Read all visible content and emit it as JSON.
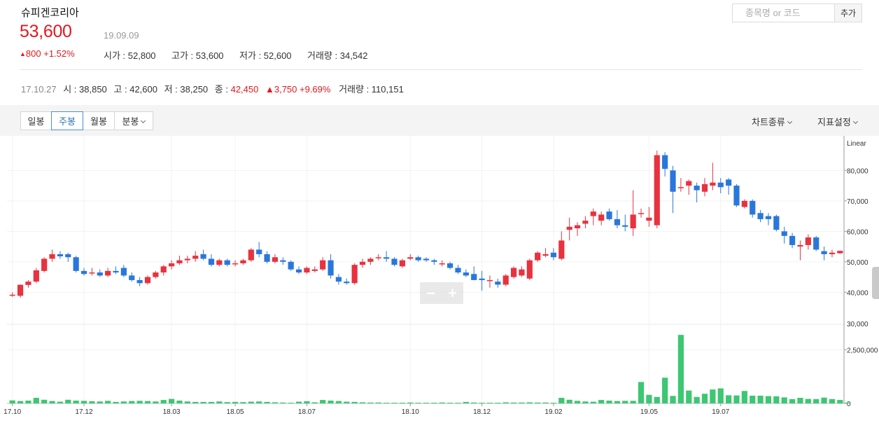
{
  "stock": {
    "name": "슈피겐코리아",
    "price": "53,600",
    "price_date": "19.09.09",
    "change_arrow": "▲",
    "change_text": "800 +1.52%",
    "quote": [
      {
        "label": "시가",
        "value": "52,800"
      },
      {
        "label": "고가",
        "value": "53,600"
      },
      {
        "label": "저가",
        "value": "52,600"
      },
      {
        "label": "거래량",
        "value": "34,542"
      }
    ]
  },
  "search": {
    "placeholder": "종목명 or 코드",
    "button": "추가"
  },
  "hover": {
    "date": "17.10.27",
    "open": "시 : 38,850",
    "high": "고 : 42,600",
    "low": "저 : 38,250",
    "close_label": "종 : ",
    "close_value": "42,450",
    "change": "▲3,750 +9.69%",
    "volume": "거래량 : 110,151"
  },
  "toolbar": {
    "tabs": [
      {
        "label": "일봉",
        "active": false
      },
      {
        "label": "주봉",
        "active": true
      },
      {
        "label": "월봉",
        "active": false
      },
      {
        "label": "분봉",
        "active": false
      }
    ],
    "chart_type": "차트종류",
    "indicator": "지표설정"
  },
  "zoom": {
    "minus": "−",
    "plus": "+"
  },
  "colors": {
    "up": "#e8323f",
    "down": "#2a77dc",
    "volume": "#3cc772",
    "accent": "#e5171d",
    "active_tab": "#2d72b8"
  },
  "chart_data": {
    "type": "candlestick",
    "scale_label": "Linear",
    "y_ticks": [
      40000,
      50000,
      60000,
      70000,
      80000
    ],
    "y_tick_labels": [
      "40,000",
      "50,000",
      "60,000",
      "70,000",
      "80,000"
    ],
    "volume_ticks": [
      0,
      2500000
    ],
    "volume_tick_labels": [
      "0",
      "2,500,000"
    ],
    "volume_top_label": "30,000",
    "x_labels": [
      "17.10",
      "17.12",
      "18.03",
      "18.05",
      "18.07",
      "18.10",
      "18.12",
      "19.02",
      "19.05",
      "19.07"
    ],
    "ohlc": [
      [
        39000,
        40000,
        38500,
        39200
      ],
      [
        38850,
        42600,
        38250,
        42450
      ],
      [
        42400,
        44000,
        41500,
        43500
      ],
      [
        43500,
        48000,
        43000,
        47200
      ],
      [
        47000,
        51500,
        46500,
        51000
      ],
      [
        51000,
        54000,
        50000,
        52500
      ],
      [
        52500,
        53500,
        51000,
        51800
      ],
      [
        52500,
        53000,
        50000,
        51500
      ],
      [
        51500,
        52000,
        46500,
        47000
      ],
      [
        47000,
        48000,
        45500,
        46000
      ],
      [
        46500,
        48000,
        45500,
        46500
      ],
      [
        46500,
        47500,
        45000,
        45500
      ],
      [
        45500,
        48000,
        45000,
        47000
      ],
      [
        47000,
        48500,
        46000,
        46500
      ],
      [
        48000,
        49000,
        45000,
        45500
      ],
      [
        45500,
        46500,
        43500,
        44000
      ],
      [
        44000,
        45000,
        42000,
        43000
      ],
      [
        43000,
        45500,
        42500,
        45000
      ],
      [
        45000,
        47000,
        44500,
        46500
      ],
      [
        46500,
        49000,
        45500,
        48500
      ],
      [
        48500,
        50500,
        47500,
        49500
      ],
      [
        49500,
        52000,
        49000,
        50500
      ],
      [
        50500,
        52000,
        49500,
        51000
      ],
      [
        51000,
        53500,
        50000,
        52000
      ],
      [
        52500,
        54000,
        50500,
        51000
      ],
      [
        51000,
        52500,
        48500,
        49000
      ],
      [
        49000,
        51000,
        48500,
        50500
      ],
      [
        50500,
        51000,
        48500,
        49000
      ],
      [
        49500,
        50500,
        48500,
        49500
      ],
      [
        49500,
        51000,
        49000,
        50500
      ],
      [
        50500,
        54500,
        50000,
        54000
      ],
      [
        54000,
        56500,
        51500,
        52500
      ],
      [
        52500,
        53500,
        49500,
        50000
      ],
      [
        50000,
        52500,
        49500,
        51500
      ],
      [
        50500,
        51500,
        49000,
        50000
      ],
      [
        50000,
        50500,
        47000,
        47500
      ],
      [
        47500,
        48500,
        46000,
        46500
      ],
      [
        46500,
        48500,
        46000,
        48000
      ],
      [
        47000,
        48500,
        46500,
        47500
      ],
      [
        47500,
        51500,
        47000,
        50500
      ],
      [
        50500,
        52500,
        44500,
        45500
      ],
      [
        45000,
        46000,
        42500,
        43500
      ],
      [
        43500,
        44500,
        42500,
        43000
      ],
      [
        43000,
        49500,
        42500,
        49000
      ],
      [
        49000,
        51000,
        48000,
        50000
      ],
      [
        50000,
        51500,
        49000,
        51000
      ],
      [
        51500,
        52500,
        50500,
        51500
      ],
      [
        51500,
        53500,
        50000,
        51000
      ],
      [
        51000,
        51500,
        48500,
        49000
      ],
      [
        48500,
        51000,
        48000,
        50500
      ],
      [
        51000,
        52500,
        50500,
        51500
      ],
      [
        51500,
        52000,
        50000,
        50500
      ],
      [
        51000,
        51500,
        50000,
        50500
      ],
      [
        50500,
        51000,
        49000,
        50000
      ],
      [
        49500,
        50500,
        48500,
        49500
      ],
      [
        49500,
        50000,
        47500,
        48000
      ],
      [
        48000,
        49000,
        46000,
        46500
      ],
      [
        46500,
        47500,
        45000,
        45500
      ],
      [
        46000,
        48500,
        45000,
        44000
      ],
      [
        44500,
        47000,
        40500,
        44000
      ],
      [
        44000,
        45500,
        41500,
        44000
      ],
      [
        43500,
        44500,
        41500,
        42500
      ],
      [
        42500,
        46000,
        42000,
        45500
      ],
      [
        45000,
        48500,
        44500,
        48000
      ],
      [
        45500,
        48500,
        45000,
        47500
      ],
      [
        44500,
        51000,
        44000,
        50500
      ],
      [
        50500,
        53500,
        50000,
        53000
      ],
      [
        52000,
        54500,
        51500,
        52500
      ],
      [
        53000,
        54500,
        50500,
        51500
      ],
      [
        51000,
        60000,
        50500,
        57000
      ],
      [
        60500,
        64500,
        57000,
        61500
      ],
      [
        61000,
        63000,
        58500,
        62000
      ],
      [
        62500,
        65000,
        61000,
        63500
      ],
      [
        65000,
        67500,
        62000,
        66500
      ],
      [
        63500,
        66500,
        62000,
        65500
      ],
      [
        66500,
        67500,
        63500,
        64000
      ],
      [
        64000,
        67000,
        61000,
        62000
      ],
      [
        62000,
        65500,
        60000,
        61500
      ],
      [
        61000,
        73500,
        58500,
        65500
      ],
      [
        66000,
        67500,
        64500,
        66000
      ],
      [
        63500,
        68000,
        61500,
        64500
      ],
      [
        62000,
        86500,
        61000,
        85000
      ],
      [
        85000,
        86000,
        78000,
        80500
      ],
      [
        80000,
        81500,
        66000,
        73000
      ],
      [
        74500,
        77500,
        73000,
        74500
      ],
      [
        75000,
        77000,
        72000,
        76500
      ],
      [
        75000,
        76000,
        69500,
        73500
      ],
      [
        73000,
        77500,
        71500,
        75500
      ],
      [
        75000,
        82500,
        73500,
        76000
      ],
      [
        76000,
        77500,
        72500,
        74500
      ],
      [
        77000,
        77500,
        72000,
        75000
      ],
      [
        75000,
        75500,
        68000,
        68500
      ],
      [
        68000,
        70500,
        67500,
        70000
      ],
      [
        70000,
        70500,
        64500,
        65500
      ],
      [
        66000,
        67000,
        63000,
        64000
      ],
      [
        65000,
        66000,
        62000,
        64000
      ],
      [
        65000,
        65500,
        60000,
        60500
      ],
      [
        60000,
        61500,
        56000,
        58500
      ],
      [
        58500,
        59500,
        54500,
        55500
      ],
      [
        55000,
        57000,
        50500,
        55500
      ],
      [
        55500,
        59000,
        54000,
        58000
      ],
      [
        58000,
        58500,
        53500,
        54000
      ],
      [
        53500,
        55000,
        50500,
        52500
      ],
      [
        52500,
        54000,
        51500,
        53000
      ],
      [
        52800,
        53600,
        52600,
        53600
      ]
    ],
    "volume": [
      140000,
      110151,
      130000,
      260000,
      170000,
      110000,
      80000,
      170000,
      130000,
      120000,
      100000,
      90000,
      120000,
      70000,
      90000,
      110000,
      120000,
      110000,
      90000,
      160000,
      210000,
      130000,
      90000,
      70000,
      70000,
      70000,
      90000,
      60000,
      70000,
      60000,
      80000,
      90000,
      70000,
      50000,
      40000,
      30000,
      80000,
      100000,
      50000,
      160000,
      130000,
      110000,
      80000,
      70000,
      50000,
      40000,
      40000,
      30000,
      30000,
      30000,
      40000,
      30000,
      30000,
      30000,
      40000,
      30000,
      30000,
      70000,
      40000,
      30000,
      30000,
      30000,
      50000,
      40000,
      40000,
      50000,
      40000,
      40000,
      30000,
      260000,
      170000,
      120000,
      90000,
      80000,
      160000,
      130000,
      110000,
      120000,
      120000,
      1000000,
      400000,
      300000,
      1200000,
      350000,
      3200000,
      600000,
      300000,
      450000,
      650000,
      700000,
      380000,
      370000,
      580000,
      360000,
      360000,
      340000,
      330000,
      280000,
      200000,
      260000,
      210000,
      200000,
      270000,
      200000,
      160000,
      34542
    ]
  }
}
